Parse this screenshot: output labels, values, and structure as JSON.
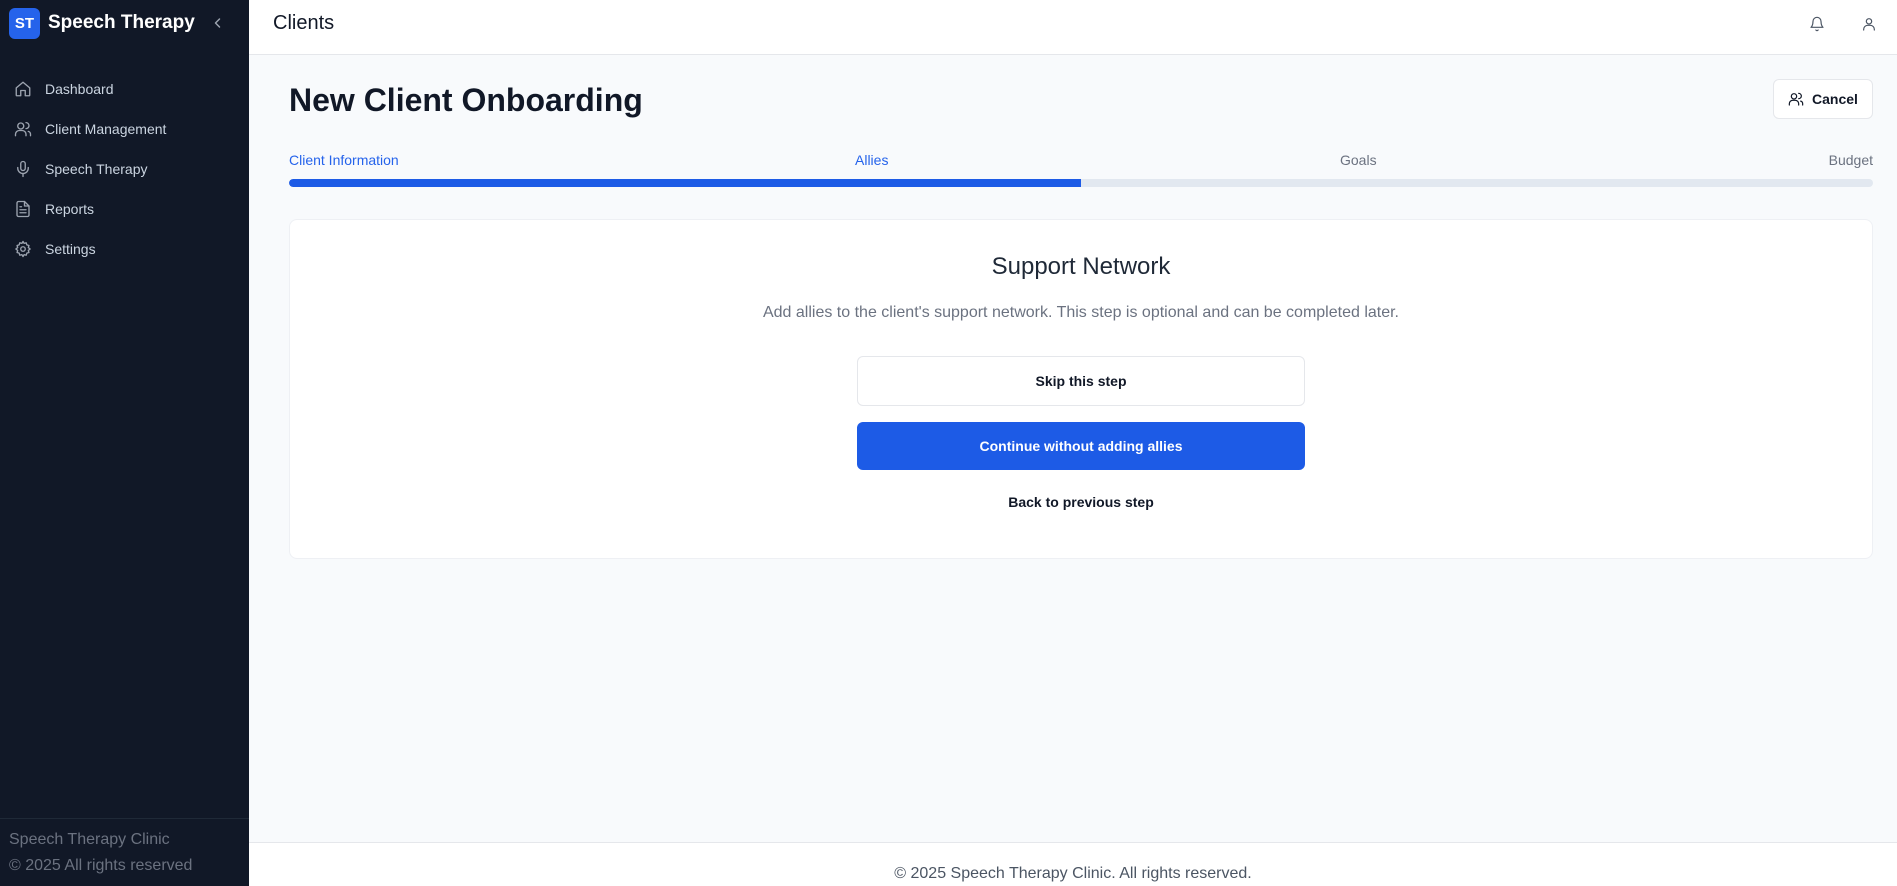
{
  "sidebar": {
    "logo_text": "ST",
    "brand_name": "Speech Therapy",
    "items": [
      {
        "label": "Dashboard",
        "icon": "home-icon"
      },
      {
        "label": "Client Management",
        "icon": "users-icon"
      },
      {
        "label": "Speech Therapy",
        "icon": "microphone-icon"
      },
      {
        "label": "Reports",
        "icon": "document-icon"
      },
      {
        "label": "Settings",
        "icon": "gear-icon"
      }
    ],
    "footer_line1": "Speech Therapy Clinic",
    "footer_line2": "© 2025 All rights reserved"
  },
  "topbar": {
    "title": "Clients",
    "icons": [
      "bell-icon",
      "user-icon"
    ]
  },
  "main": {
    "page_title": "New Client Onboarding",
    "cancel_label": "Cancel",
    "steps": [
      {
        "label": "Client Information",
        "state": "active"
      },
      {
        "label": "Allies",
        "state": "active"
      },
      {
        "label": "Goals",
        "state": "inactive"
      },
      {
        "label": "Budget",
        "state": "inactive"
      }
    ],
    "progress_fraction": 0.5,
    "card": {
      "title": "Support Network",
      "description": "Add allies to the client's support network. This step is optional and can be completed later.",
      "skip_label": "Skip this step",
      "continue_label": "Continue without adding allies",
      "back_label": "Back to previous step"
    }
  },
  "footer": {
    "text": "© 2025 Speech Therapy Clinic. All rights reserved."
  },
  "colors": {
    "accent": "#1d5be6",
    "sidebar_bg": "#111827",
    "page_bg": "#f8fafc"
  }
}
